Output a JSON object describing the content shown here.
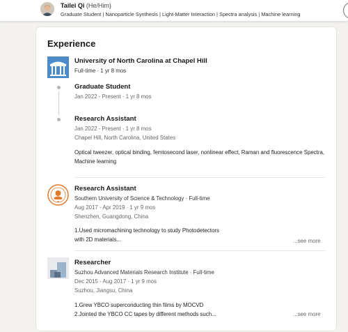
{
  "profile": {
    "name": "Tailei Qi",
    "pronouns": "(He/Him)",
    "headline": "Graduate Student | Nanoparticle Synthesis | Light-Matter Interaction | Spectra analysis | Machine learning"
  },
  "experience": {
    "title": "Experience",
    "unc": {
      "org": "University of North Carolina at Chapel Hill",
      "summary": "Full-time · 1 yr 8 mos",
      "roles": [
        {
          "title": "Graduate Student",
          "dates": "Jan 2022 - Present · 1 yr 8 mos"
        },
        {
          "title": "Research Assistant",
          "dates": "Jan 2022 - Present · 1 yr 8 mos",
          "location": "Chapel Hill, North Carolina, United States",
          "description": "Optical tweezer, optical binding, femtosecond laser, nonlinear effect, Raman and fluorescence Spectra, Machine learning"
        }
      ]
    },
    "sustech": {
      "title": "Research Assistant",
      "org": "Southern University of Science & Technology · Full-time",
      "dates": "Aug 2017 - Apr 2019 · 1 yr 9 mos",
      "location": "Shenzhen, Guangdong, China",
      "description_line1": "1.Used micromachining technology to study Photodetectors",
      "description_line2": "with 2D materials...",
      "see_more": "...see more"
    },
    "suzhou": {
      "title": "Researcher",
      "org": "Suzhou Advanced Materials Research Institute · Full-time",
      "dates": "Dec 2015 - Aug 2017 · 1 yr 9 mos",
      "location": "Suzhou, Jiangsu, China",
      "description_line1": "1.Grew YBCO superconducting thin films by MOCVD",
      "description_line2": "2.Jointed the YBCO CC tapes by different methods such...",
      "see_more": "...see more"
    }
  },
  "colors": {
    "page_bg": "#f3f2ef",
    "card_bg": "#ffffff",
    "unc_blue": "#4b8cc8",
    "sustech_orange": "#e07a2c"
  },
  "icons": {
    "unc_logo": "old-well-icon",
    "sustech_logo": "sustech-seal-icon",
    "suzhou_logo": "sairi-logo-icon"
  }
}
